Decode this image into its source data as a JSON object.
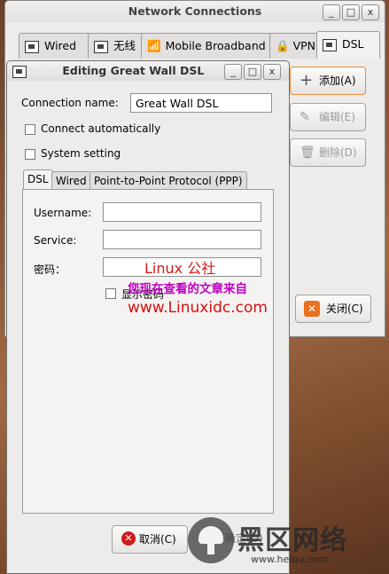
{
  "net_window": {
    "title": "Network Connections",
    "buttons": [
      "_",
      "□",
      "x"
    ],
    "tabs": [
      "Wired",
      "无线",
      "Mobile Broadband",
      "VPN",
      "DSL"
    ],
    "active_tab": "DSL",
    "add_label": "添加(A)",
    "edit_label": "编辑(E)",
    "delete_label": "删除(D)",
    "close_label": "关闭(C)"
  },
  "dialog": {
    "title": "Editing Great Wall DSL",
    "buttons": [
      "_",
      "□",
      "x"
    ],
    "connection_name_label": "Connection name:",
    "connection_name_value": "Great Wall DSL",
    "connect_automatically": "Connect automatically",
    "system_setting": "System setting",
    "tabs": [
      "DSL",
      "Wired",
      "Point-to-Point Protocol (PPP)"
    ],
    "username_label": "Username:",
    "service_label": "Service:",
    "password_label": "密码：",
    "show_password_label": "显示密码",
    "cancel_label": "取消(C)",
    "ok_label": "确定(O)"
  },
  "watermark": {
    "line1": "Linux 公社",
    "line2": "您现在查看的文章来自",
    "line3": "www.Linuxidc.com",
    "corner_big": "黑区网络",
    "corner_small": "www.heiqu.com"
  },
  "colors": {
    "accent_orange": "#e86a1a",
    "watermark_red": "#d01818",
    "watermark_magenta": "#c000c0"
  }
}
